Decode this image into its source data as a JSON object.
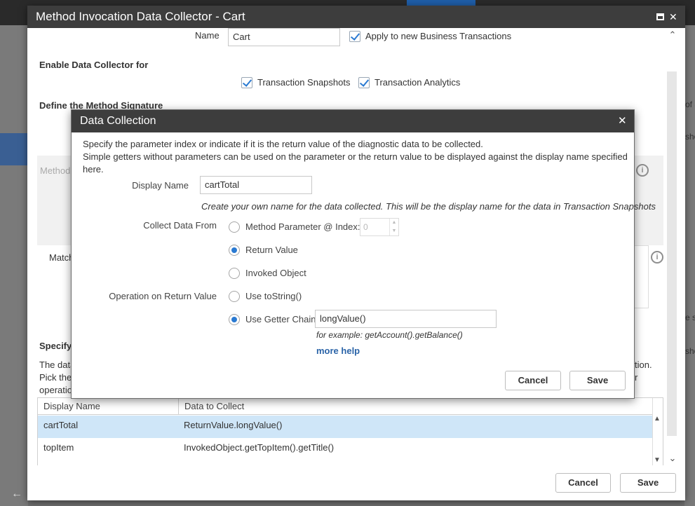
{
  "background": {
    "right_fragments": [
      "of a",
      "sho",
      "e se",
      "sho"
    ]
  },
  "window": {
    "title": "Method Invocation Data Collector - Cart",
    "maximize_glyph": "",
    "close_glyph": "✕"
  },
  "form": {
    "name_label": "Name",
    "name_value": "Cart",
    "apply_new_bt_label": "Apply to new Business Transactions",
    "enable_section_title": "Enable Data Collector for",
    "snapshots_label": "Transaction Snapshots",
    "analytics_label": "Transaction Analytics",
    "signature_section_title": "Define the Method Signature",
    "method_label_partial": "Method",
    "match_label_partial": "Match",
    "specify_title_partial": "Specify",
    "desc_line1_left": "The data",
    "desc_line1_right": "tion.",
    "desc_line2_left": "Pick the",
    "desc_line2_right": "r",
    "desc_line3_left": "operatio"
  },
  "table": {
    "columns": [
      "Display Name",
      "Data to Collect"
    ],
    "rows": [
      {
        "name": "cartTotal",
        "data": "ReturnValue.longValue()",
        "selected": true
      },
      {
        "name": "topItem",
        "data": "InvokedObject.getTopItem().getTitle()",
        "selected": false
      }
    ]
  },
  "footer": {
    "cancel_label": "Cancel",
    "save_label": "Save"
  },
  "dialog": {
    "title": "Data Collection",
    "close_glyph": "✕",
    "intro_line1": "Specify the parameter index or indicate if it is the return value of the diagnostic data to be collected.",
    "intro_line2": "Simple getters without parameters can be used on the parameter or the return value to be displayed against the display name specified",
    "intro_line3": "here.",
    "display_name_label": "Display Name",
    "display_name_value": "cartTotal",
    "display_name_hint": "Create your own name for the data collected.  This will be the display name for the data in Transaction Snapshots",
    "collect_from_label": "Collect Data From",
    "opt_method_param": "Method Parameter @ Index:",
    "param_index_value": "0",
    "opt_return_value": "Return Value",
    "opt_invoked_object": "Invoked Object",
    "operation_label": "Operation on Return Value",
    "opt_tostring": "Use toString()",
    "opt_getter_chain": "Use Getter Chain",
    "getter_chain_value": "longValue()",
    "getter_example": "for example: getAccount().getBalance()",
    "more_help": "more help",
    "cancel_label": "Cancel",
    "save_label": "Save"
  }
}
